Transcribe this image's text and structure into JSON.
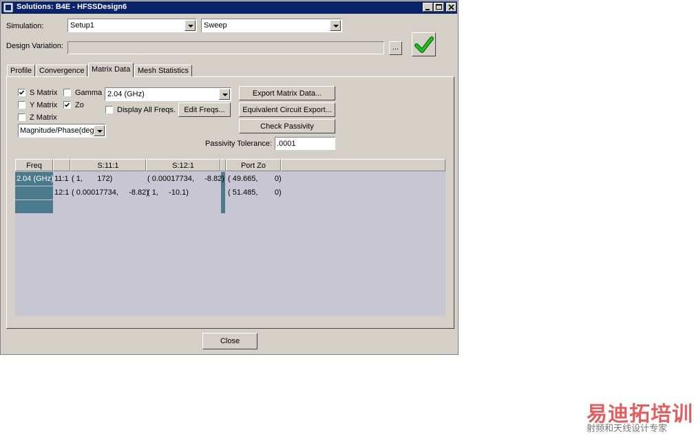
{
  "window": {
    "title": "Solutions: B4E - HFSSDesign6"
  },
  "simulation": {
    "label": "Simulation:",
    "setup_value": "Setup1",
    "sweep_value": "Sweep"
  },
  "design_variation": {
    "label": "Design Variation:",
    "value": "",
    "browse_label": "..."
  },
  "tabs": [
    {
      "label": "Profile"
    },
    {
      "label": "Convergence"
    },
    {
      "label": "Matrix Data"
    },
    {
      "label": "Mesh Statistics"
    }
  ],
  "matrix": {
    "s_matrix": {
      "label": "S Matrix",
      "checked": true
    },
    "gamma": {
      "label": "Gamma",
      "checked": false
    },
    "y_matrix": {
      "label": "Y Matrix",
      "checked": false
    },
    "zo": {
      "label": "Zo",
      "checked": true
    },
    "z_matrix": {
      "label": "Z Matrix",
      "checked": false
    },
    "freq_value": "2.04 (GHz)",
    "display_all_freqs": {
      "label": "Display All Freqs.",
      "checked": false
    },
    "edit_freqs_label": "Edit Freqs...",
    "format_value": "Magnitude/Phase(deg",
    "export_matrix_label": "Export Matrix Data...",
    "equiv_circuit_label": "Equivalent Circuit Export...",
    "check_passivity_label": "Check Passivity",
    "passivity_tolerance_label": "Passivity Tolerance:",
    "passivity_tolerance_value": ".0001"
  },
  "table": {
    "headers": [
      "Freq",
      "",
      "S:11:1",
      "S:12:1",
      "",
      "Port Zo"
    ],
    "freq_cell": "2.04 (GHz)",
    "rows": [
      {
        "name": "11:1",
        "s11": "( 1,       172)",
        "s12": "( 0.00017734,     -8.82)",
        "zo": "( 49.665,        0)"
      },
      {
        "name": "12:1",
        "s11": "( 0.00017734,     -8.82)",
        "s12": "( 1,     -10.1)",
        "zo": "( 51.485,        0)"
      }
    ]
  },
  "close_label": "Close",
  "watermark": {
    "main": "易迪拓培训",
    "sub": "射频和天线设计专家"
  },
  "colors": {
    "titlebar": "#0a246a",
    "panel": "#d4d0c8",
    "grid_bg": "#c7c6d2",
    "freq_cell": "#4a7a8c",
    "check": "#1aa81a",
    "watermark": "#e06060"
  }
}
